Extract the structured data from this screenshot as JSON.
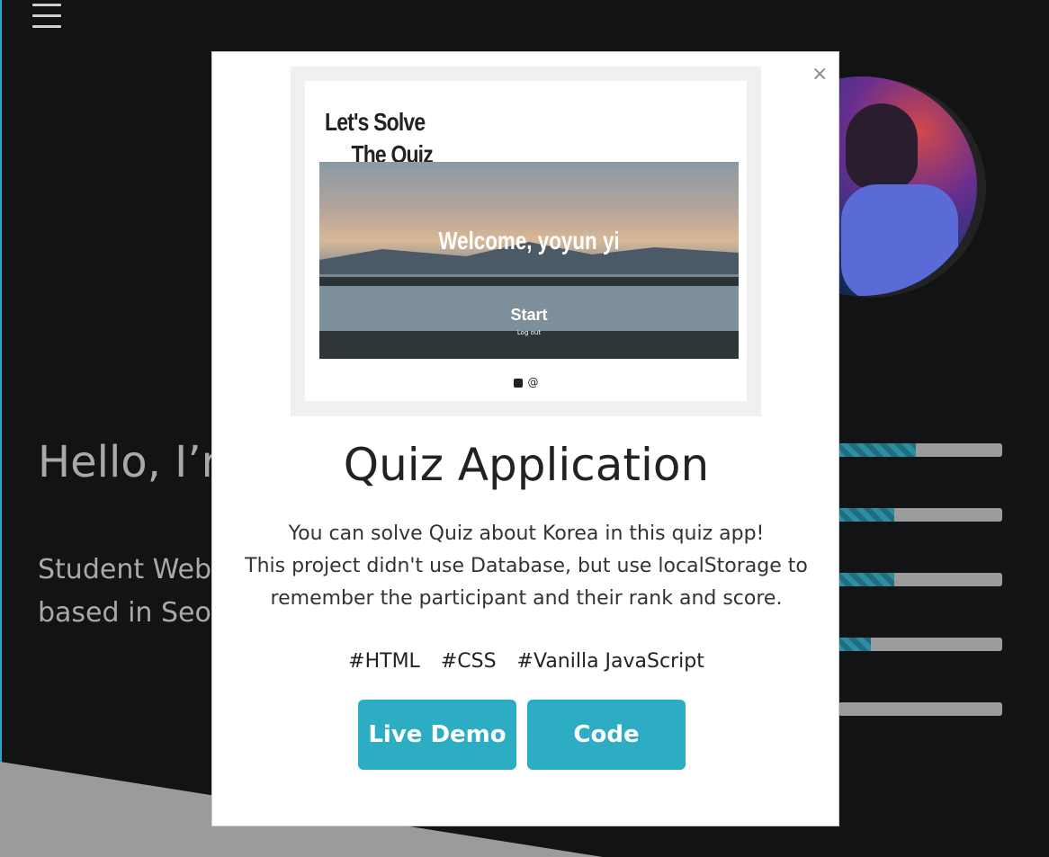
{
  "page": {
    "menu_icon": "hamburger-icon",
    "hero": {
      "title": "Hello, I’r",
      "subtitle_line1": "Student Web",
      "subtitle_line2": "based in Seo"
    },
    "skills": [
      {
        "level": 0.47
      },
      {
        "level": 0.34
      },
      {
        "level": 0.34
      },
      {
        "level": 0.2
      },
      {
        "level": 0.0
      }
    ],
    "colors": {
      "background": "#111315",
      "accent": "#2cadc3",
      "skill_track": "#9b9b9b"
    }
  },
  "modal": {
    "close_label": "×",
    "preview": {
      "title_line1": "Let's Solve",
      "title_line2": "The Quiz",
      "welcome": "Welcome, yoyun yi",
      "start": "Start",
      "logout": "Log out",
      "at_symbol": "@"
    },
    "title": "Quiz Application",
    "description": [
      "You can solve Quiz about Korea in this quiz app!",
      "This project didn't use Database, but use localStorage to",
      "remember the participant and their rank and score."
    ],
    "tags": [
      "#HTML",
      "#CSS",
      "#Vanilla JavaScript"
    ],
    "buttons": {
      "demo": "Live Demo",
      "code": "Code"
    }
  }
}
